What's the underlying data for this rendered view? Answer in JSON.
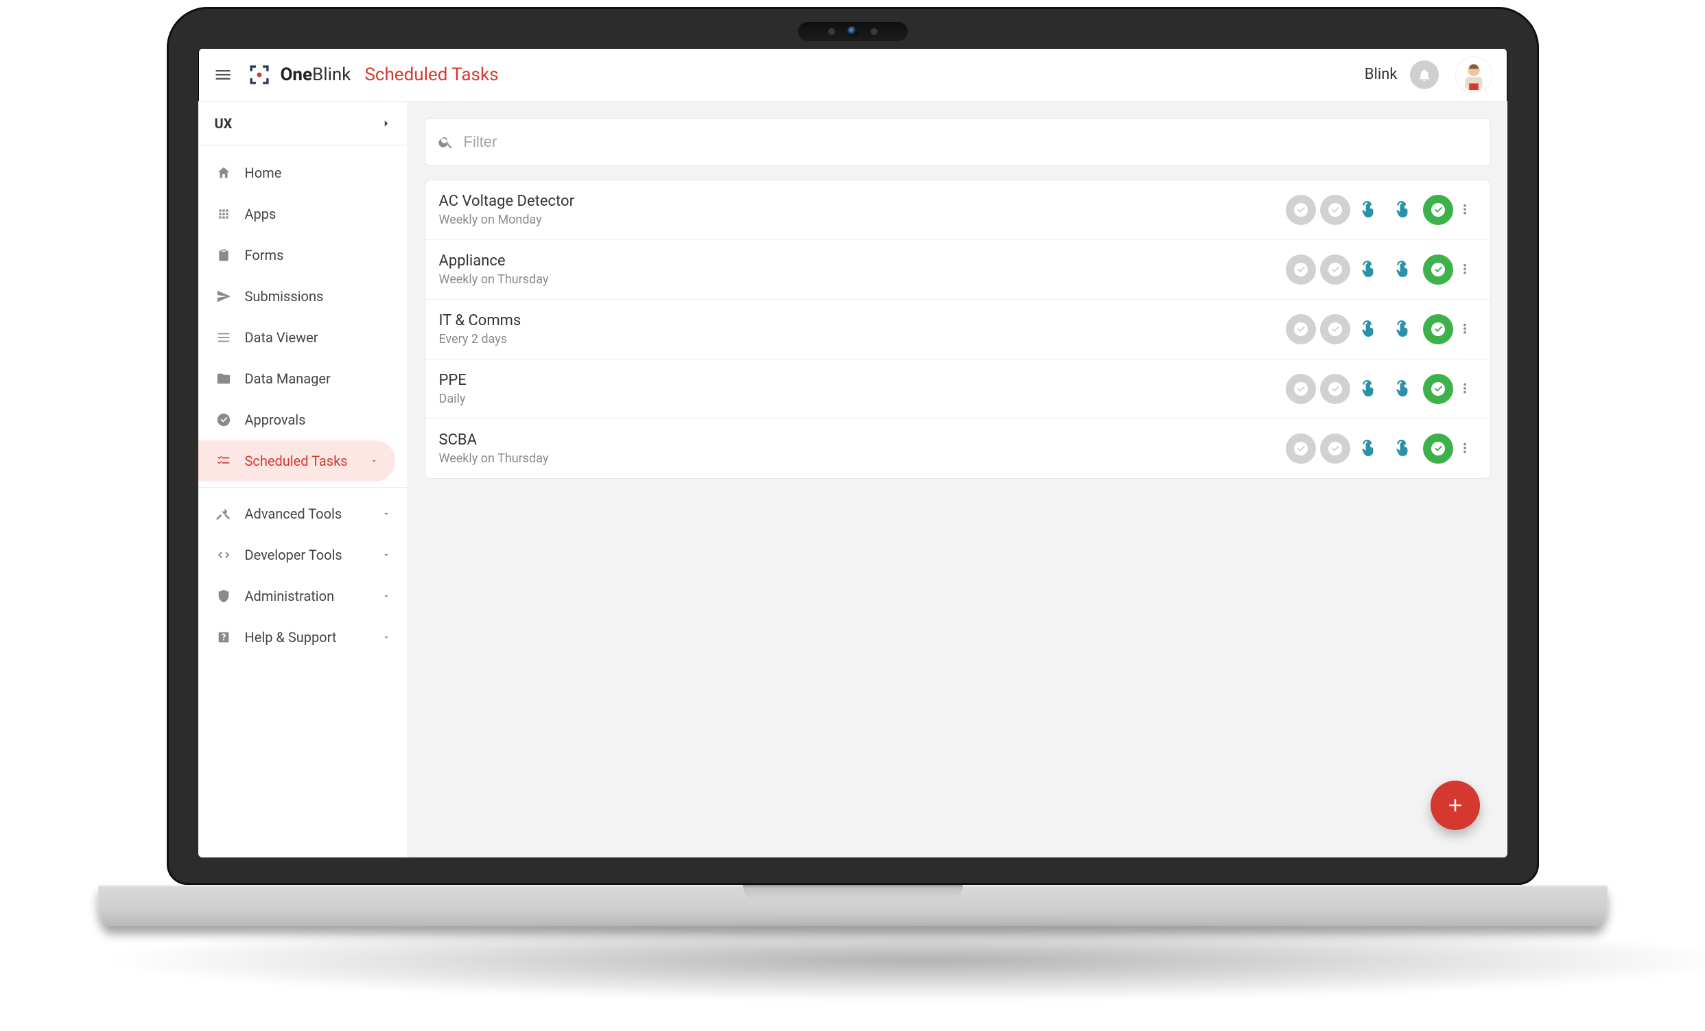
{
  "header": {
    "brand_prefix": "One",
    "brand_suffix": "Blink",
    "page_title": "Scheduled Tasks",
    "user_label": "Blink"
  },
  "sidebar": {
    "workspace": "UX",
    "items": [
      {
        "label": "Home"
      },
      {
        "label": "Apps"
      },
      {
        "label": "Forms"
      },
      {
        "label": "Submissions"
      },
      {
        "label": "Data Viewer"
      },
      {
        "label": "Data Manager"
      },
      {
        "label": "Approvals"
      },
      {
        "label": "Scheduled Tasks"
      }
    ],
    "groups": [
      {
        "label": "Advanced Tools"
      },
      {
        "label": "Developer Tools"
      },
      {
        "label": "Administration"
      },
      {
        "label": "Help & Support"
      }
    ]
  },
  "filter": {
    "placeholder": "Filter"
  },
  "tasks": [
    {
      "title": "AC Voltage Detector",
      "schedule": "Weekly on Monday"
    },
    {
      "title": "Appliance",
      "schedule": "Weekly on Thursday"
    },
    {
      "title": "IT & Comms",
      "schedule": "Every 2 days"
    },
    {
      "title": "PPE",
      "schedule": "Daily"
    },
    {
      "title": "SCBA",
      "schedule": "Weekly on Thursday"
    }
  ],
  "colors": {
    "accent": "#d4382f",
    "teal": "#2a91a8",
    "green": "#3db24b",
    "grey_chip": "#d1d1d1"
  }
}
